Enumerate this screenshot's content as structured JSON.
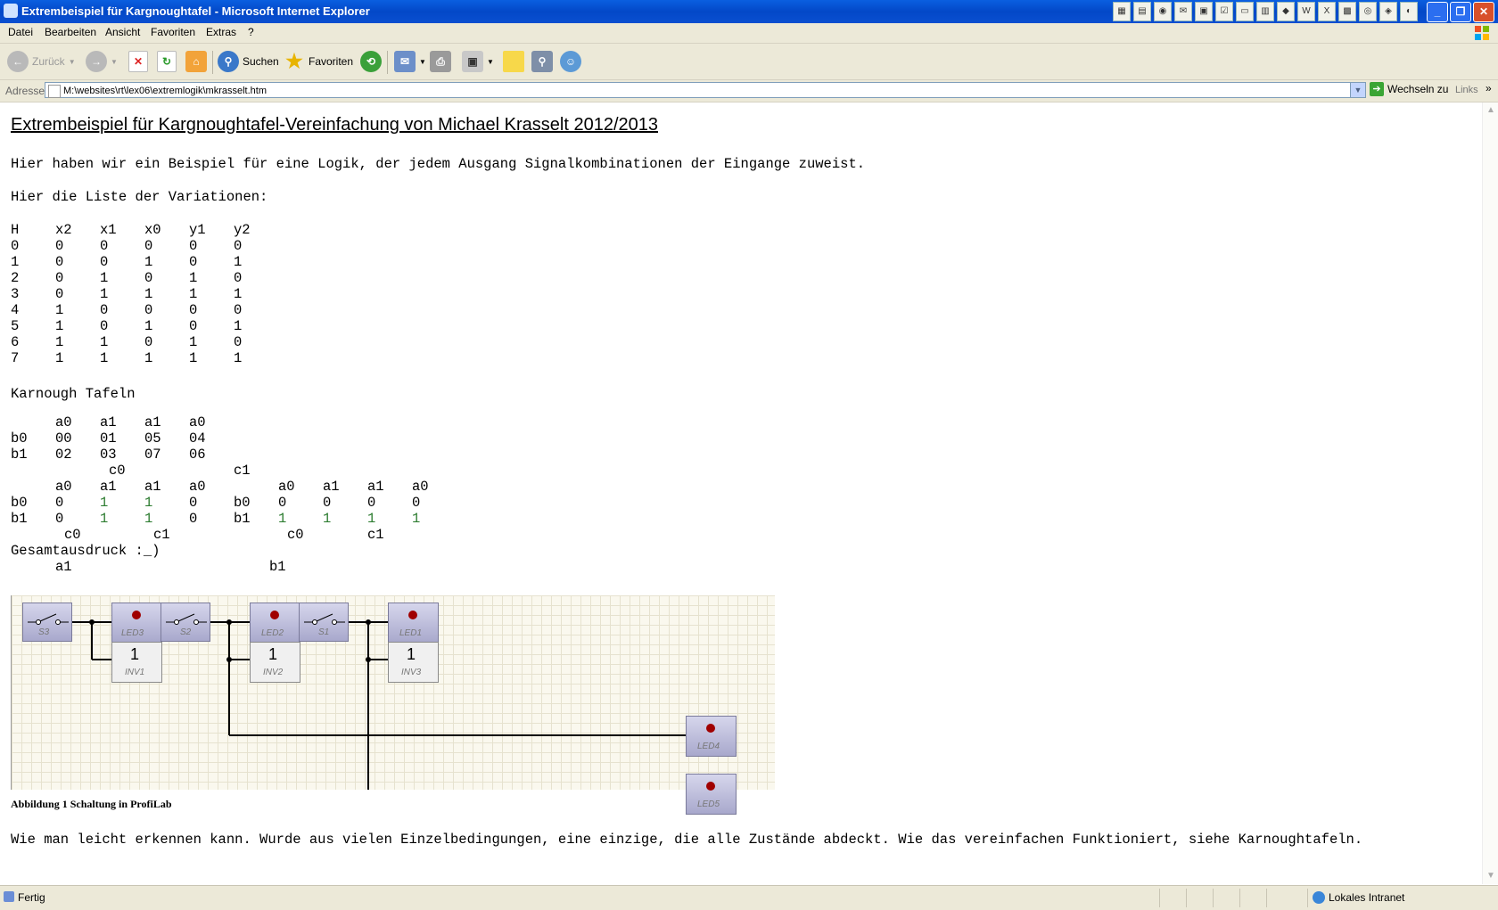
{
  "window": {
    "title": "Extrembeispiel für Kargnoughtafel - Microsoft Internet Explorer"
  },
  "menu": [
    "Datei",
    "Bearbeiten",
    "Ansicht",
    "Favoriten",
    "Extras",
    "?"
  ],
  "toolbar": {
    "back": "Zurück",
    "search": "Suchen",
    "favorites": "Favoriten"
  },
  "address": {
    "label": "Adresse",
    "url": "M:\\websites\\rt\\lex06\\extremlogik\\mkrasselt.htm",
    "go": "Wechseln zu",
    "links": "Links"
  },
  "page": {
    "heading": "Extrembeispiel für Kargnoughtafel-Vereinfachung von Michael Krasselt 2012/2013",
    "intro": "Hier haben wir ein Beispiel für eine Logik, der jedem Ausgang Signalkombinationen der Eingange zuweist.",
    "list_title": "Hier die Liste der Variationen:",
    "table": {
      "headers": [
        "H",
        "x2",
        "x1",
        "x0",
        "y1",
        "y2"
      ],
      "rows": [
        [
          "0",
          "0",
          "0",
          "0",
          "0",
          "0"
        ],
        [
          "1",
          "0",
          "0",
          "1",
          "0",
          "1"
        ],
        [
          "2",
          "0",
          "1",
          "0",
          "1",
          "0"
        ],
        [
          "3",
          "0",
          "1",
          "1",
          "1",
          "1"
        ],
        [
          "4",
          "1",
          "0",
          "0",
          "0",
          "0"
        ],
        [
          "5",
          "1",
          "0",
          "1",
          "0",
          "1"
        ],
        [
          "6",
          "1",
          "1",
          "0",
          "1",
          "0"
        ],
        [
          "7",
          "1",
          "1",
          "1",
          "1",
          "1"
        ]
      ]
    },
    "karnaugh_title": "Karnough Tafeln",
    "k_head": [
      "a0",
      "a1",
      "a1",
      "a0"
    ],
    "k_r1": [
      "b0",
      "00",
      "01",
      "05",
      "04"
    ],
    "k_r2": [
      "b1",
      "02",
      "03",
      "07",
      "06"
    ],
    "k_c0": "c0",
    "k_c1": "c1",
    "k2_head_left": [
      "a0",
      "a1",
      "a1",
      "a0"
    ],
    "k2_head_right": [
      "a0",
      "a1",
      "a1",
      "a0"
    ],
    "k2_r1_left": [
      "b0",
      "0",
      "1",
      "1",
      "0"
    ],
    "k2_r1_right": [
      "b0",
      "0",
      "0",
      "0",
      "0"
    ],
    "k2_r2_left": [
      "b1",
      "0",
      "1",
      "1",
      "0"
    ],
    "k2_r2_right": [
      "b1",
      "1",
      "1",
      "1",
      "1"
    ],
    "k2_foot_left": [
      "c0",
      "c1"
    ],
    "k2_foot_right": [
      "c0",
      "c1"
    ],
    "gesamt": "Gesamtausdruck :_)",
    "gesamt_a": "a1",
    "gesamt_b": "b1",
    "circuit": {
      "switches": [
        "S3",
        "S2",
        "S1"
      ],
      "leds": [
        "LED3",
        "LED2",
        "LED1",
        "LED4",
        "LED5"
      ],
      "inverters": [
        "INV1",
        "INV2",
        "INV3"
      ],
      "inv_symbol": "1"
    },
    "caption": "Abbildung 1 Schaltung in ProfiLab",
    "closing": "Wie man leicht erkennen kann. Wurde aus vielen Einzelbedingungen, eine einzige, die alle Zustände abdeckt. Wie das vereinfachen Funktioniert, siehe Karnoughtafeln."
  },
  "status": {
    "left": "Fertig",
    "zone": "Lokales Intranet"
  }
}
